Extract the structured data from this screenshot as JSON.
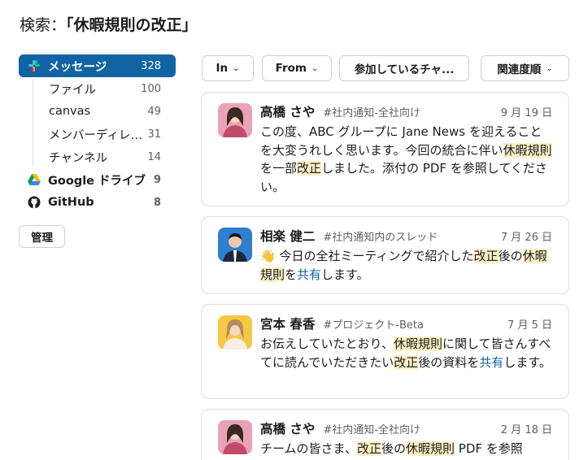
{
  "search": {
    "prefix": "検索：",
    "query": "「休暇規則の改正」"
  },
  "sidebar": {
    "messages": {
      "label": "メッセージ",
      "count": "328"
    },
    "sub_items": [
      {
        "label": "ファイル",
        "count": "100"
      },
      {
        "label": "canvas",
        "count": "49"
      },
      {
        "label": "メンバーディレクトリ",
        "count": "31"
      },
      {
        "label": "チャンネル",
        "count": "14"
      }
    ],
    "sources": [
      {
        "label": "Google ドライブ",
        "count": "9",
        "icon": "google-drive-icon"
      },
      {
        "label": "GitHub",
        "count": "8",
        "icon": "github-icon"
      }
    ],
    "manage_label": "管理"
  },
  "filters": [
    {
      "label": "In"
    },
    {
      "label": "From"
    },
    {
      "label": "参加しているチャ..."
    },
    {
      "label": "関連度順"
    }
  ],
  "results": [
    {
      "author": "高橋 さや",
      "channel": "#社内通知-全社向け",
      "date": "9 月 19 日",
      "body": [
        "この度、ABC グループに Jane News を迎えることを大変うれしく思います。今回の統合に伴い",
        "休暇規則",
        "を一部",
        "改正",
        "しました。添付の PDF を参照してください。"
      ]
    },
    {
      "author": "相楽 健二",
      "channel": "#社内通知内のスレッド",
      "date": "7 月 26 日",
      "body": [
        "👋 今日の全社ミーティングで紹介した",
        "改正",
        "後の",
        "休暇規則",
        "を",
        "共有",
        "します。"
      ]
    },
    {
      "author": "宮本 春香",
      "channel": "#プロジェクト-Beta",
      "date": "7 月 5 日",
      "body": [
        "お伝えしていたとおり、",
        "休暇規則",
        "に関して皆さんすべてに読んでいただきたい",
        "改正",
        "後の資料を",
        "共有",
        "します。"
      ]
    },
    {
      "author": "高橋 さや",
      "channel": "#社内通知-全社向け",
      "date": "2 月 18 日",
      "body": [
        "チームの皆さま、",
        "改正",
        "後の",
        "休暇規則",
        " PDF を参照"
      ]
    }
  ],
  "colors": {
    "accent": "#1164a3",
    "highlight": "#fdf0c4",
    "link": "#1264a3"
  }
}
